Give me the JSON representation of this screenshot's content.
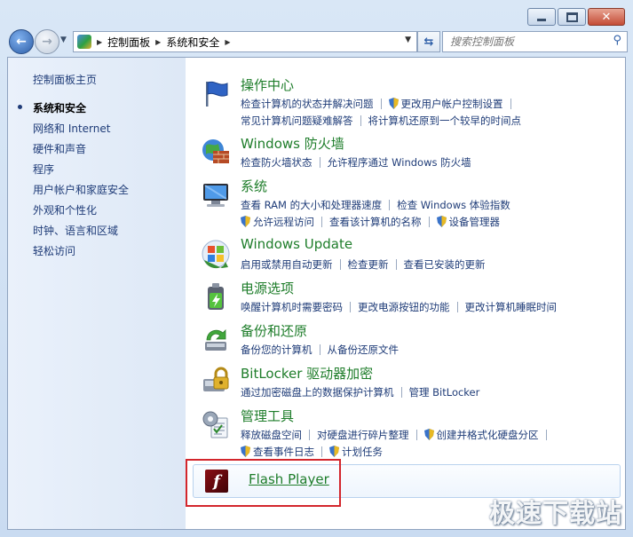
{
  "navbar": {
    "breadcrumbs": [
      "控制面板",
      "系统和安全"
    ],
    "search_placeholder": "搜索控制面板"
  },
  "sidebar": {
    "items": [
      {
        "label": "控制面板主页",
        "current": false
      },
      {
        "label": "系统和安全",
        "current": true
      },
      {
        "label": "网络和 Internet",
        "current": false
      },
      {
        "label": "硬件和声音",
        "current": false
      },
      {
        "label": "程序",
        "current": false
      },
      {
        "label": "用户帐户和家庭安全",
        "current": false
      },
      {
        "label": "外观和个性化",
        "current": false
      },
      {
        "label": "时钟、语言和区域",
        "current": false
      },
      {
        "label": "轻松访问",
        "current": false
      }
    ]
  },
  "categories": [
    {
      "title": "操作中心",
      "icon": "flag-icon",
      "links": [
        "检查计算机的状态并解决问题",
        "更改用户帐户控制设置",
        "常见计算机问题疑难解答",
        "将计算机还原到一个较早的时间点"
      ]
    },
    {
      "title": "Windows 防火墙",
      "icon": "firewall-icon",
      "links": [
        "检查防火墙状态",
        "允许程序通过 Windows 防火墙"
      ]
    },
    {
      "title": "系统",
      "icon": "computer-icon",
      "links": [
        "查看 RAM 的大小和处理器速度",
        "检查 Windows 体验指数",
        "允许远程访问",
        "查看该计算机的名称",
        "设备管理器"
      ]
    },
    {
      "title": "Windows Update",
      "icon": "windows-update-icon",
      "links": [
        "启用或禁用自动更新",
        "检查更新",
        "查看已安装的更新"
      ]
    },
    {
      "title": "电源选项",
      "icon": "battery-icon",
      "links": [
        "唤醒计算机时需要密码",
        "更改电源按钮的功能",
        "更改计算机睡眠时间"
      ]
    },
    {
      "title": "备份和还原",
      "icon": "backup-icon",
      "links": [
        "备份您的计算机",
        "从备份还原文件"
      ]
    },
    {
      "title": "BitLocker 驱动器加密",
      "icon": "bitlocker-icon",
      "links": [
        "通过加密磁盘上的数据保护计算机",
        "管理 BitLocker"
      ]
    },
    {
      "title": "管理工具",
      "icon": "admin-tools-icon",
      "links": [
        "释放磁盘空间",
        "对硬盘进行碎片整理",
        "创建并格式化硬盘分区",
        "查看事件日志",
        "计划任务"
      ]
    }
  ],
  "flash": {
    "title": "Flash Player",
    "icon_glyph": "f"
  },
  "watermark": "极速下载站",
  "colors": {
    "link": "#1f3c78",
    "title_green": "#1e7d2a",
    "highlight_red": "#d3262c"
  }
}
